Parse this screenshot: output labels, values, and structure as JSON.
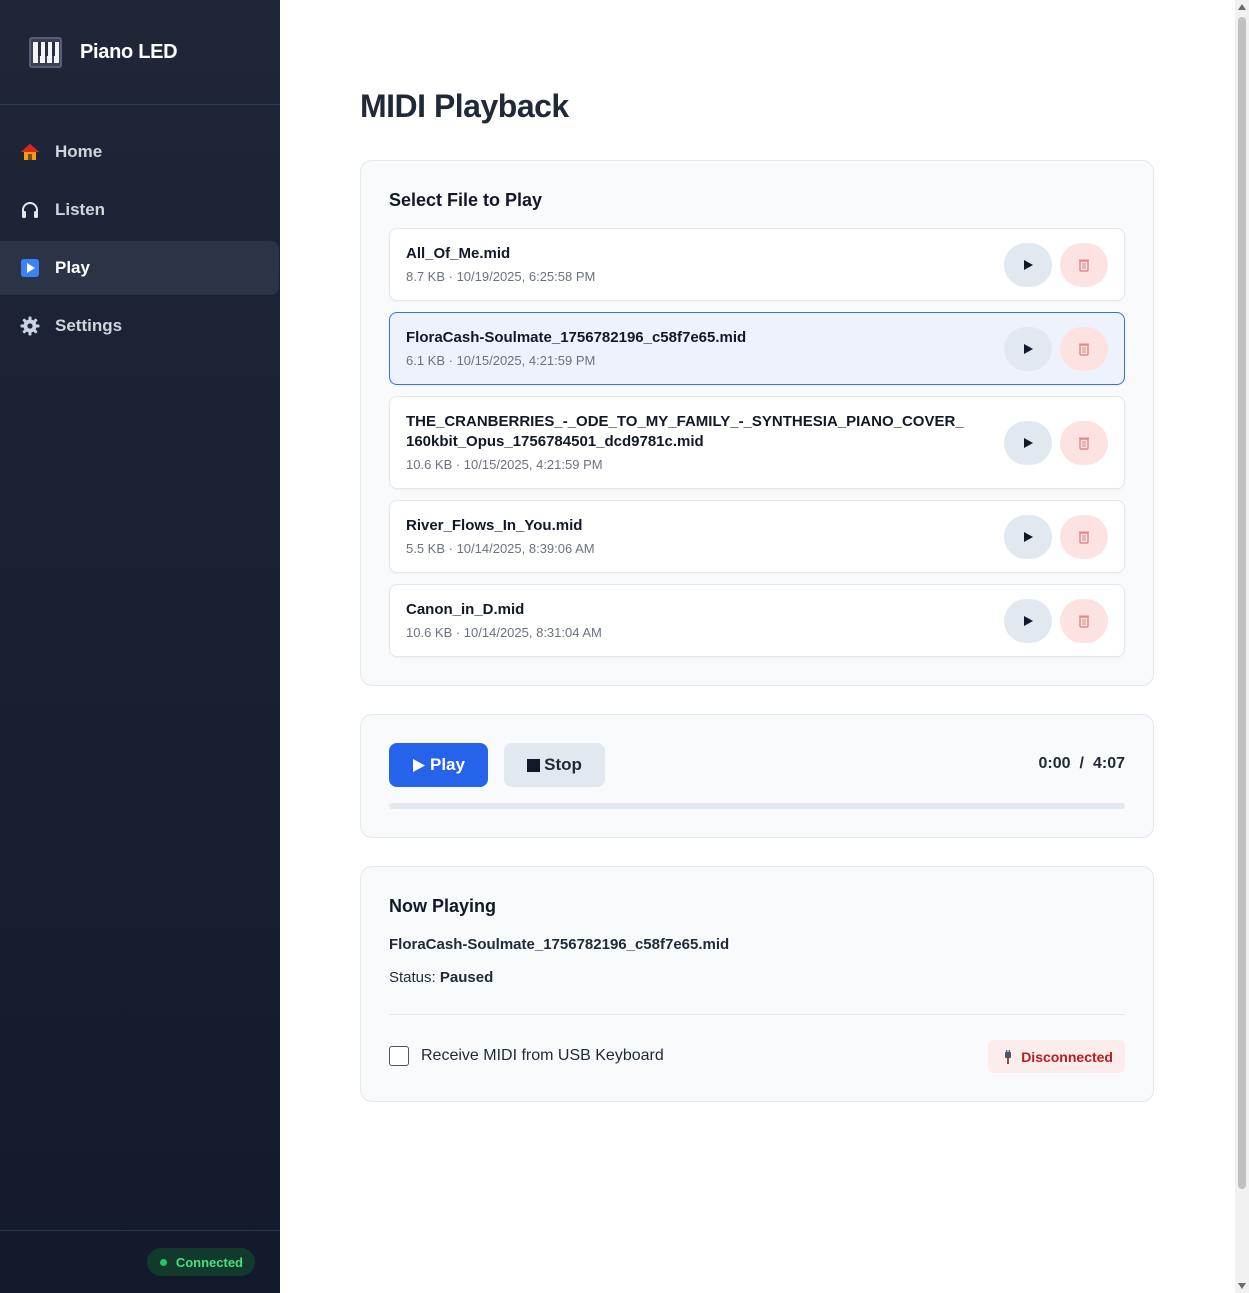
{
  "sidebar": {
    "brand_title": "Piano LED",
    "nav": [
      {
        "label": "Home",
        "icon": "house-icon",
        "active": false
      },
      {
        "label": "Listen",
        "icon": "headphones-icon",
        "active": false
      },
      {
        "label": "Play",
        "icon": "play-square-icon",
        "active": true
      },
      {
        "label": "Settings",
        "icon": "gear-icon",
        "active": false
      }
    ],
    "connection_status": "Connected"
  },
  "main": {
    "page_title": "MIDI Playback",
    "file_section": {
      "title": "Select File to Play",
      "files": [
        {
          "name": "All_Of_Me.mid",
          "meta": "8.7 KB · 10/19/2025, 6:25:58 PM",
          "selected": false
        },
        {
          "name": "FloraCash-Soulmate_1756782196_c58f7e65.mid",
          "meta": "6.1 KB · 10/15/2025, 4:21:59 PM",
          "selected": true
        },
        {
          "name": "THE_CRANBERRIES_-_ODE_TO_MY_FAMILY_-_SYNTHESIA_PIANO_COVER_160kbit_Opus_1756784501_dcd9781c.mid",
          "meta": "10.6 KB · 10/15/2025, 4:21:59 PM",
          "selected": false
        },
        {
          "name": "River_Flows_In_You.mid",
          "meta": "5.5 KB · 10/14/2025, 8:39:06 AM",
          "selected": false
        },
        {
          "name": "Canon_in_D.mid",
          "meta": "10.6 KB · 10/14/2025, 8:31:04 AM",
          "selected": false
        }
      ]
    },
    "controls": {
      "play_label": "Play",
      "stop_label": "Stop",
      "current_time": "0:00",
      "separator": "/",
      "total_time": "4:07",
      "progress": 0
    },
    "now_playing": {
      "title": "Now Playing",
      "file": "FloraCash-Soulmate_1756782196_c58f7e65.mid",
      "status_label": "Status:",
      "status_value": "Paused",
      "usb_label": "Receive MIDI from USB Keyboard",
      "usb_checked": false,
      "usb_status": "Disconnected"
    }
  },
  "colors": {
    "accent": "#2563eb",
    "sidebar_bg": "#1e2638",
    "connected": "#22c55e",
    "disconnected": "#b91c1c"
  }
}
